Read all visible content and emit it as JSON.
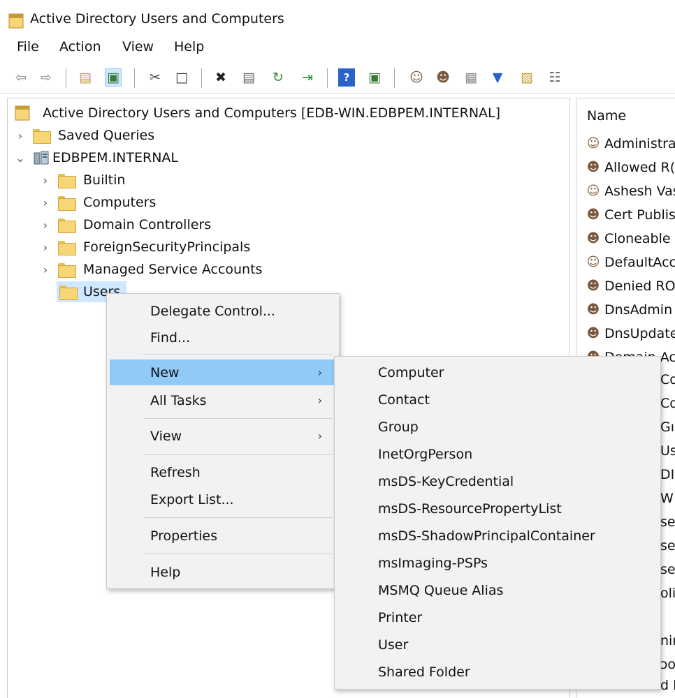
{
  "window": {
    "title": "Active Directory Users and Computers"
  },
  "menubar": [
    "File",
    "Action",
    "View",
    "Help"
  ],
  "toolbar": {
    "icons": [
      "back-arrow-icon",
      "forward-arrow-icon",
      "up-folder-icon",
      "show-hide-console-tree-icon",
      "cut-icon",
      "copy-icon",
      "delete-icon",
      "properties-icon",
      "refresh-icon",
      "export-list-icon",
      "help-icon",
      "show-action-pane-icon",
      "new-user-icon",
      "new-group-icon",
      "new-ou-icon",
      "filter-icon",
      "find-icon",
      "delegate-icon"
    ]
  },
  "tree": {
    "root": "Active Directory Users and Computers [EDB-WIN.EDBPEM.INTERNAL]",
    "saved_queries": "Saved Queries",
    "domain": "EDBPEM.INTERNAL",
    "children": [
      "Builtin",
      "Computers",
      "Domain Controllers",
      "ForeignSecurityPrincipals",
      "Managed Service Accounts",
      "Users"
    ]
  },
  "list": {
    "column": "Name",
    "items": [
      "Administra",
      "Allowed R(",
      "Ashesh Vas",
      "Cert Publis",
      "Cloneable",
      "DefaultAcc",
      "Denied RO",
      "DnsAdmin",
      "DnsUpdate",
      "Domain Ac"
    ],
    "partial": [
      "Co",
      "Co",
      "Gı",
      "Us",
      "DI",
      "W",
      "se",
      "se",
      "se",
      "oli",
      "nir",
      "ɔo",
      "d l"
    ]
  },
  "context_menu": {
    "items": [
      "Delegate Control...",
      "Find...",
      "New",
      "All Tasks",
      "View",
      "Refresh",
      "Export List...",
      "Properties",
      "Help"
    ],
    "highlighted": "New"
  },
  "submenu_new": {
    "items": [
      "Computer",
      "Contact",
      "Group",
      "InetOrgPerson",
      "msDS-KeyCredential",
      "msDS-ResourcePropertyList",
      "msDS-ShadowPrincipalContainer",
      "msImaging-PSPs",
      "MSMQ Queue Alias",
      "Printer",
      "User",
      "Shared Folder"
    ]
  },
  "colors": {
    "selection": "#cde8ff",
    "menu_highlight": "#91c9f7",
    "menu_bg": "#f2f2f2",
    "folder": "#f6d676"
  }
}
